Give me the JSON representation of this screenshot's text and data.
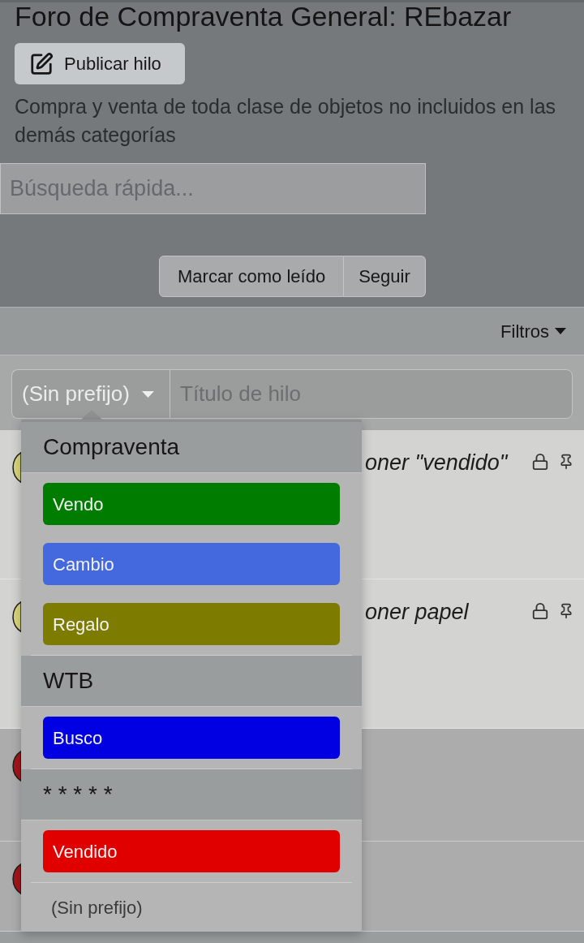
{
  "forum": {
    "title": "Foro de Compraventa General: REbazar",
    "post_button": "Publicar hilo",
    "description": "Compra y venta de toda clase de objetos no incluidos en las demás categorías"
  },
  "search": {
    "placeholder": "Búsqueda rápida..."
  },
  "actions": [
    {
      "label": "Marcar como leído"
    },
    {
      "label": "Seguir"
    }
  ],
  "filters": {
    "label": "Filtros"
  },
  "new_thread": {
    "prefix_select": {
      "value": "(Sin prefijo)"
    },
    "title_field": {
      "placeholder": "Título de hilo"
    }
  },
  "threads": [
    {
      "title": "oner \"vendido\"",
      "color": "#d9d47c",
      "locked": true,
      "sticky": true
    },
    {
      "title": "oner papel",
      "color": "#d9d47c",
      "locked": true,
      "sticky": true
    },
    {
      "color": "#a3151a",
      "locked": false,
      "sticky": false
    },
    {
      "color": "#a3151a",
      "locked": false,
      "sticky": false
    }
  ],
  "prefix_menu": {
    "groups": [
      {
        "label": "Compraventa",
        "items": [
          {
            "label": "Vendo",
            "color": "#007c00"
          },
          {
            "label": "Cambio",
            "color": "#4468dd"
          },
          {
            "label": "Regalo",
            "color": "#7d7c00"
          }
        ]
      },
      {
        "label": "WTB",
        "items": [
          {
            "label": "Busco",
            "color": "#0000e3"
          }
        ]
      },
      {
        "label": "* * * * *",
        "items": [
          {
            "label": "Vendido",
            "color": "#e10000"
          }
        ]
      }
    ],
    "none_option": "(Sin prefijo)"
  }
}
